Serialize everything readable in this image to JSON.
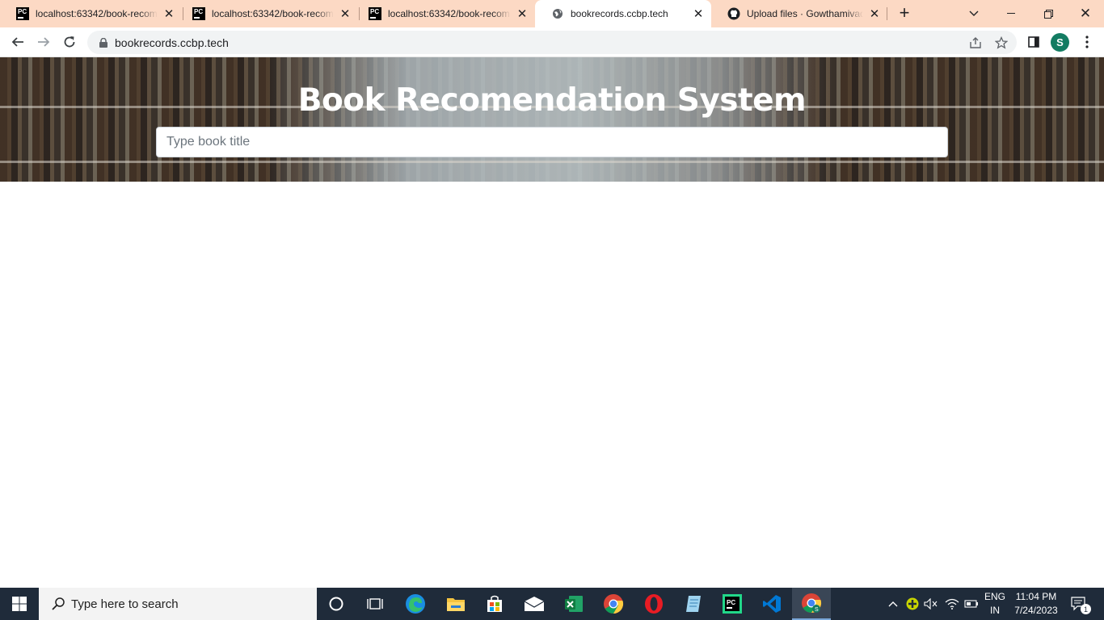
{
  "browser": {
    "tabs": [
      {
        "title": "localhost:63342/book-recom",
        "favicon": "pycharm-icon"
      },
      {
        "title": "localhost:63342/book-recom",
        "favicon": "pycharm-icon"
      },
      {
        "title": "localhost:63342/book-recom",
        "favicon": "pycharm-icon"
      },
      {
        "title": "bookrecords.ccbp.tech",
        "favicon": "globe-icon",
        "active": true
      },
      {
        "title": "Upload files · Gowthamivadd",
        "favicon": "github-icon"
      }
    ],
    "url": "bookrecords.ccbp.tech",
    "profile_initial": "S"
  },
  "page": {
    "title": "Book Recomendation System",
    "search": {
      "placeholder": "Type book title",
      "value": ""
    }
  },
  "taskbar": {
    "search_placeholder": "Type here to search",
    "apps": [
      "cortana-icon",
      "task-view-icon",
      "edge-icon",
      "file-explorer-icon",
      "store-icon",
      "mail-icon",
      "excel-icon",
      "chrome-icon",
      "opera-icon",
      "notepad-icon",
      "pycharm-icon",
      "vscode-icon",
      "chrome-profile-icon"
    ],
    "language_line1": "ENG",
    "language_line2": "IN",
    "time": "11:04 PM",
    "date": "7/24/2023",
    "notification_count": "1"
  },
  "colors": {
    "tabstrip": "#fcd9c4",
    "taskbar": "#1f2b3a",
    "profile": "#137c62"
  }
}
